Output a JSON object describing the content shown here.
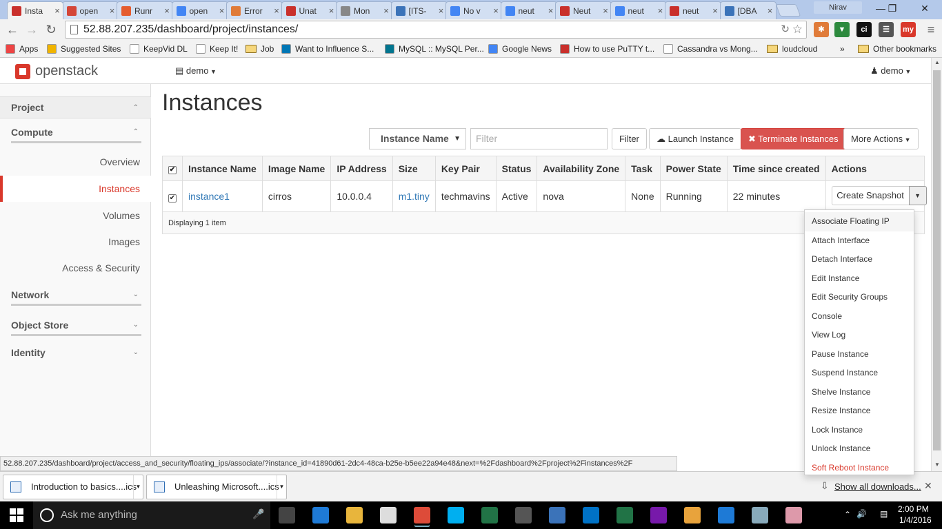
{
  "browser": {
    "tabs": [
      {
        "title": "Insta",
        "color": "#c9302c",
        "active": true
      },
      {
        "title": "open",
        "color": "#d44638"
      },
      {
        "title": "Runr",
        "color": "#e55c2f"
      },
      {
        "title": "open",
        "color": "#4285f4"
      },
      {
        "title": "Error",
        "color": "#e07b39"
      },
      {
        "title": "Unat",
        "color": "#c9302c"
      },
      {
        "title": "Mon",
        "color": "#888888"
      },
      {
        "title": "[ITS-",
        "color": "#3b73b9"
      },
      {
        "title": "No v",
        "color": "#4285f4"
      },
      {
        "title": "neut",
        "color": "#4285f4"
      },
      {
        "title": "Neut",
        "color": "#c9302c"
      },
      {
        "title": "neut",
        "color": "#4285f4"
      },
      {
        "title": "neut",
        "color": "#c9302c"
      },
      {
        "title": "[DBA",
        "color": "#3b73b9"
      }
    ],
    "profile_name": "Nirav",
    "url": "52.88.207.235/dashboard/project/instances/",
    "bookmarks": [
      {
        "label": "Apps",
        "icon": "apps-icon"
      },
      {
        "label": "Suggested Sites",
        "icon": "bing-icon"
      },
      {
        "label": "KeepVid DL",
        "icon": "page-icon"
      },
      {
        "label": "Keep It!",
        "icon": "page-icon"
      },
      {
        "label": "Job",
        "icon": "folder-icon"
      },
      {
        "label": "Want to Influence S...",
        "icon": "linkedin-icon"
      },
      {
        "label": "MySQL :: MySQL Per...",
        "icon": "mysql-icon"
      },
      {
        "label": "Google News",
        "icon": "news-icon"
      },
      {
        "label": "How to use PuTTY t...",
        "icon": "java-icon"
      },
      {
        "label": "Cassandra vs Mong...",
        "icon": "page-icon"
      },
      {
        "label": "loudcloud",
        "icon": "folder-icon"
      }
    ],
    "more_bookmarks": "»",
    "other_bookmarks": "Other bookmarks"
  },
  "app": {
    "logo": "openstack",
    "project_selector": "demo",
    "user_menu": "demo"
  },
  "sidebar": {
    "project": "Project",
    "compute": "Compute",
    "compute_items": [
      "Overview",
      "Instances",
      "Volumes",
      "Images",
      "Access & Security"
    ],
    "network": "Network",
    "object_store": "Object Store",
    "identity": "Identity"
  },
  "main": {
    "title": "Instances",
    "filter_select": "Instance Name",
    "filter_placeholder": "Filter",
    "filter_button": "Filter",
    "launch_button": "Launch Instance",
    "terminate_button": "Terminate Instances",
    "more_actions": "More Actions",
    "columns": [
      "Instance Name",
      "Image Name",
      "IP Address",
      "Size",
      "Key Pair",
      "Status",
      "Availability Zone",
      "Task",
      "Power State",
      "Time since created",
      "Actions"
    ],
    "rows": [
      {
        "instance_name": "instance1",
        "image_name": "cirros",
        "ip": "10.0.0.4",
        "size": "m1.tiny",
        "key_pair": "techmavins",
        "status": "Active",
        "zone": "nova",
        "task": "None",
        "power": "Running",
        "age": "22 minutes",
        "action": "Create Snapshot"
      }
    ],
    "footer": "Displaying 1 item"
  },
  "action_menu": [
    "Associate Floating IP",
    "Attach Interface",
    "Detach Interface",
    "Edit Instance",
    "Edit Security Groups",
    "Console",
    "View Log",
    "Pause Instance",
    "Suspend Instance",
    "Shelve Instance",
    "Resize Instance",
    "Lock Instance",
    "Unlock Instance",
    "Soft Reboot Instance"
  ],
  "status_url": "52.88.207.235/dashboard/project/access_and_security/floating_ips/associate/?instance_id=41890d61-2dc4-48ca-b25e-b5ee22a94e48&next=%2Fdashboard%2Fproject%2Finstances%2F",
  "downloads": {
    "items": [
      "Introduction to basics....ics",
      "Unleashing Microsoft....ics"
    ],
    "show_all": "Show all downloads..."
  },
  "taskbar": {
    "search_placeholder": "Ask me anything",
    "time": "2:00 PM",
    "date": "1/4/2016"
  },
  "colors": {
    "accent": "#d9382b",
    "link": "#337ab7",
    "danger_button": "#d9534f"
  }
}
